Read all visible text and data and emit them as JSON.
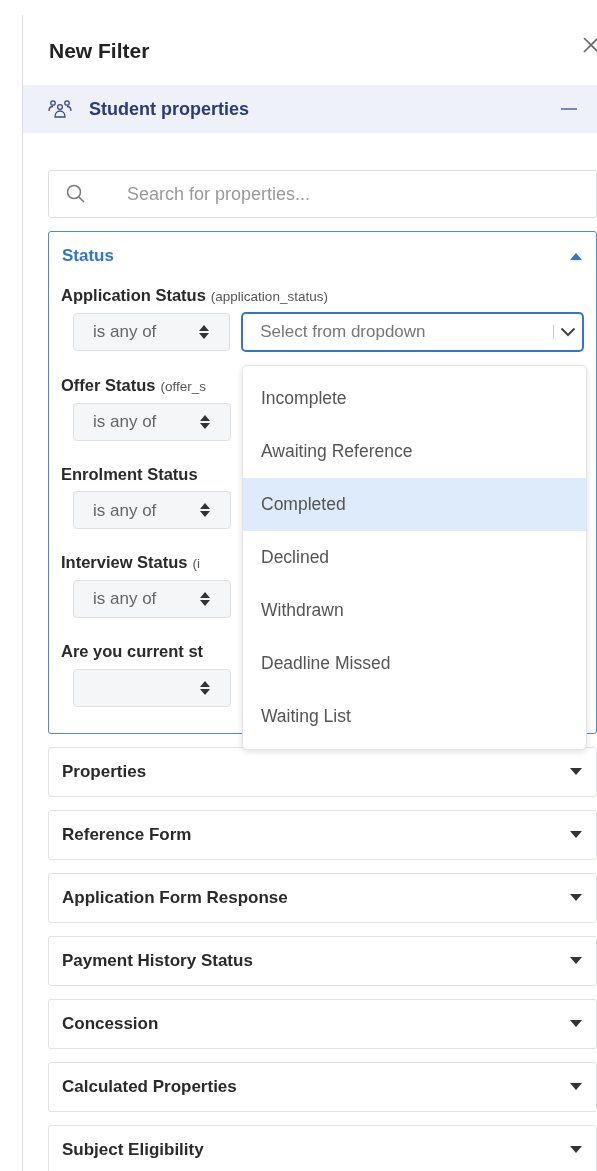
{
  "panel": {
    "title": "New Filter"
  },
  "group": {
    "title": "Student properties",
    "expanded": true
  },
  "search": {
    "placeholder": "Search for properties..."
  },
  "sections": [
    {
      "title": "Status",
      "expanded": true,
      "fields": [
        {
          "label": "Application Status",
          "key": "(application_status)",
          "operator": "is any of",
          "dropdown": {
            "placeholder": "Select from dropdown",
            "open": true,
            "options": [
              {
                "label": "Incomplete",
                "highlighted": false
              },
              {
                "label": "Awaiting Reference",
                "highlighted": false
              },
              {
                "label": "Completed",
                "highlighted": true
              },
              {
                "label": "Declined",
                "highlighted": false
              },
              {
                "label": "Withdrawn",
                "highlighted": false
              },
              {
                "label": "Deadline Missed",
                "highlighted": false
              },
              {
                "label": "Waiting List",
                "highlighted": false
              }
            ]
          }
        },
        {
          "label": "Offer Status",
          "key": "(offer_s",
          "operator": "is any of"
        },
        {
          "label": "Enrolment Status",
          "operator": "is any of"
        },
        {
          "label": "Interview Status",
          "key": "(i",
          "operator": "is any of"
        },
        {
          "label": "Are you current st"
        }
      ]
    },
    {
      "title": "Properties",
      "expanded": false
    },
    {
      "title": "Reference Form",
      "expanded": false
    },
    {
      "title": "Application Form Response",
      "expanded": false
    },
    {
      "title": "Payment History Status",
      "expanded": false
    },
    {
      "title": "Concession",
      "expanded": false
    },
    {
      "title": "Calculated Properties",
      "expanded": false
    },
    {
      "title": "Subject Eligibility",
      "expanded": false
    }
  ]
}
